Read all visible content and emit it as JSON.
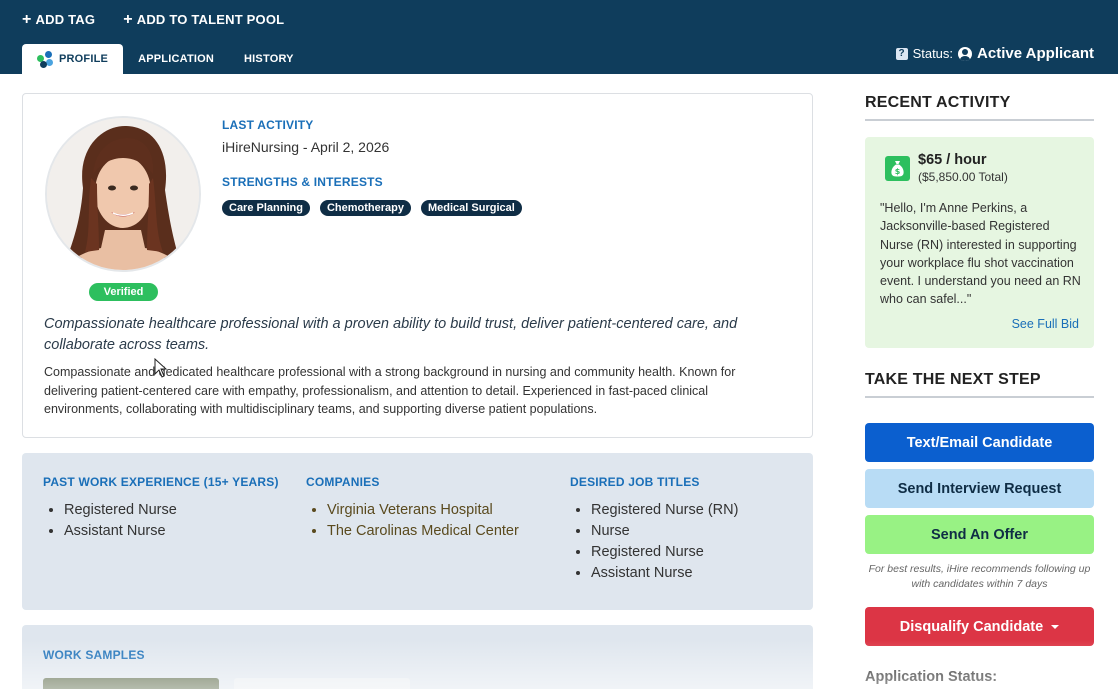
{
  "toolbar": {
    "add_tag": "ADD TAG",
    "add_to_talent_pool": "ADD TO TALENT POOL"
  },
  "tabs": [
    {
      "label": "PROFILE",
      "active": true
    },
    {
      "label": "APPLICATION",
      "active": false
    },
    {
      "label": "HISTORY",
      "active": false
    }
  ],
  "status": {
    "label": "Status:",
    "value": "Active Applicant"
  },
  "profile": {
    "verified_badge": "Verified",
    "last_activity_label": "LAST ACTIVITY",
    "last_activity_value": "iHireNursing - April 2, 2026",
    "strengths_label": "STRENGTHS & INTERESTS",
    "strengths": [
      "Care Planning",
      "Chemotherapy",
      "Medical Surgical"
    ],
    "headline": "Compassionate healthcare professional with a proven ability to build trust, deliver patient-centered care, and collaborate across teams.",
    "summary": "Compassionate and dedicated healthcare professional with a strong background in nursing and community health. Known for delivering patient-centered care with empathy, professionalism, and attention to detail. Experienced in fast-paced clinical environments, collaborating with multidisciplinary teams, and supporting diverse patient populations."
  },
  "experience": {
    "past_work_label": "PAST WORK EXPERIENCE (15+ YEARS)",
    "past_work": [
      "Registered Nurse",
      "Assistant Nurse"
    ],
    "companies_label": "COMPANIES",
    "companies": [
      "Virginia Veterans Hospital",
      "The Carolinas Medical Center"
    ],
    "desired_titles_label": "DESIRED JOB TITLES",
    "desired_titles": [
      "Registered Nurse (RN)",
      "Nurse",
      "Registered Nurse",
      "Assistant Nurse"
    ]
  },
  "work_samples": {
    "label": "WORK SAMPLES"
  },
  "recent_activity": {
    "heading": "RECENT ACTIVITY",
    "rate": "$65 / hour",
    "total": "($5,850.00 Total)",
    "quote": "\"Hello, I'm Anne Perkins, a Jacksonville-based Registered Nurse (RN) interested in supporting your workplace flu shot vaccination event. I understand you need an RN who can safel...\"",
    "see_full_bid": "See Full Bid"
  },
  "next_step": {
    "heading": "TAKE THE NEXT STEP",
    "text_email": "Text/Email Candidate",
    "interview": "Send Interview Request",
    "offer": "Send An Offer",
    "hint": "For best results, iHire recommends following up with candidates within 7 days",
    "disqualify": "Disqualify Candidate"
  },
  "application_status": {
    "label": "Application Status:"
  },
  "colors": {
    "header_bg": "#0f3d5c",
    "accent_blue": "#0b5fcf",
    "verified_green": "#2dbf5e",
    "disqualify_red": "#dc3545"
  }
}
